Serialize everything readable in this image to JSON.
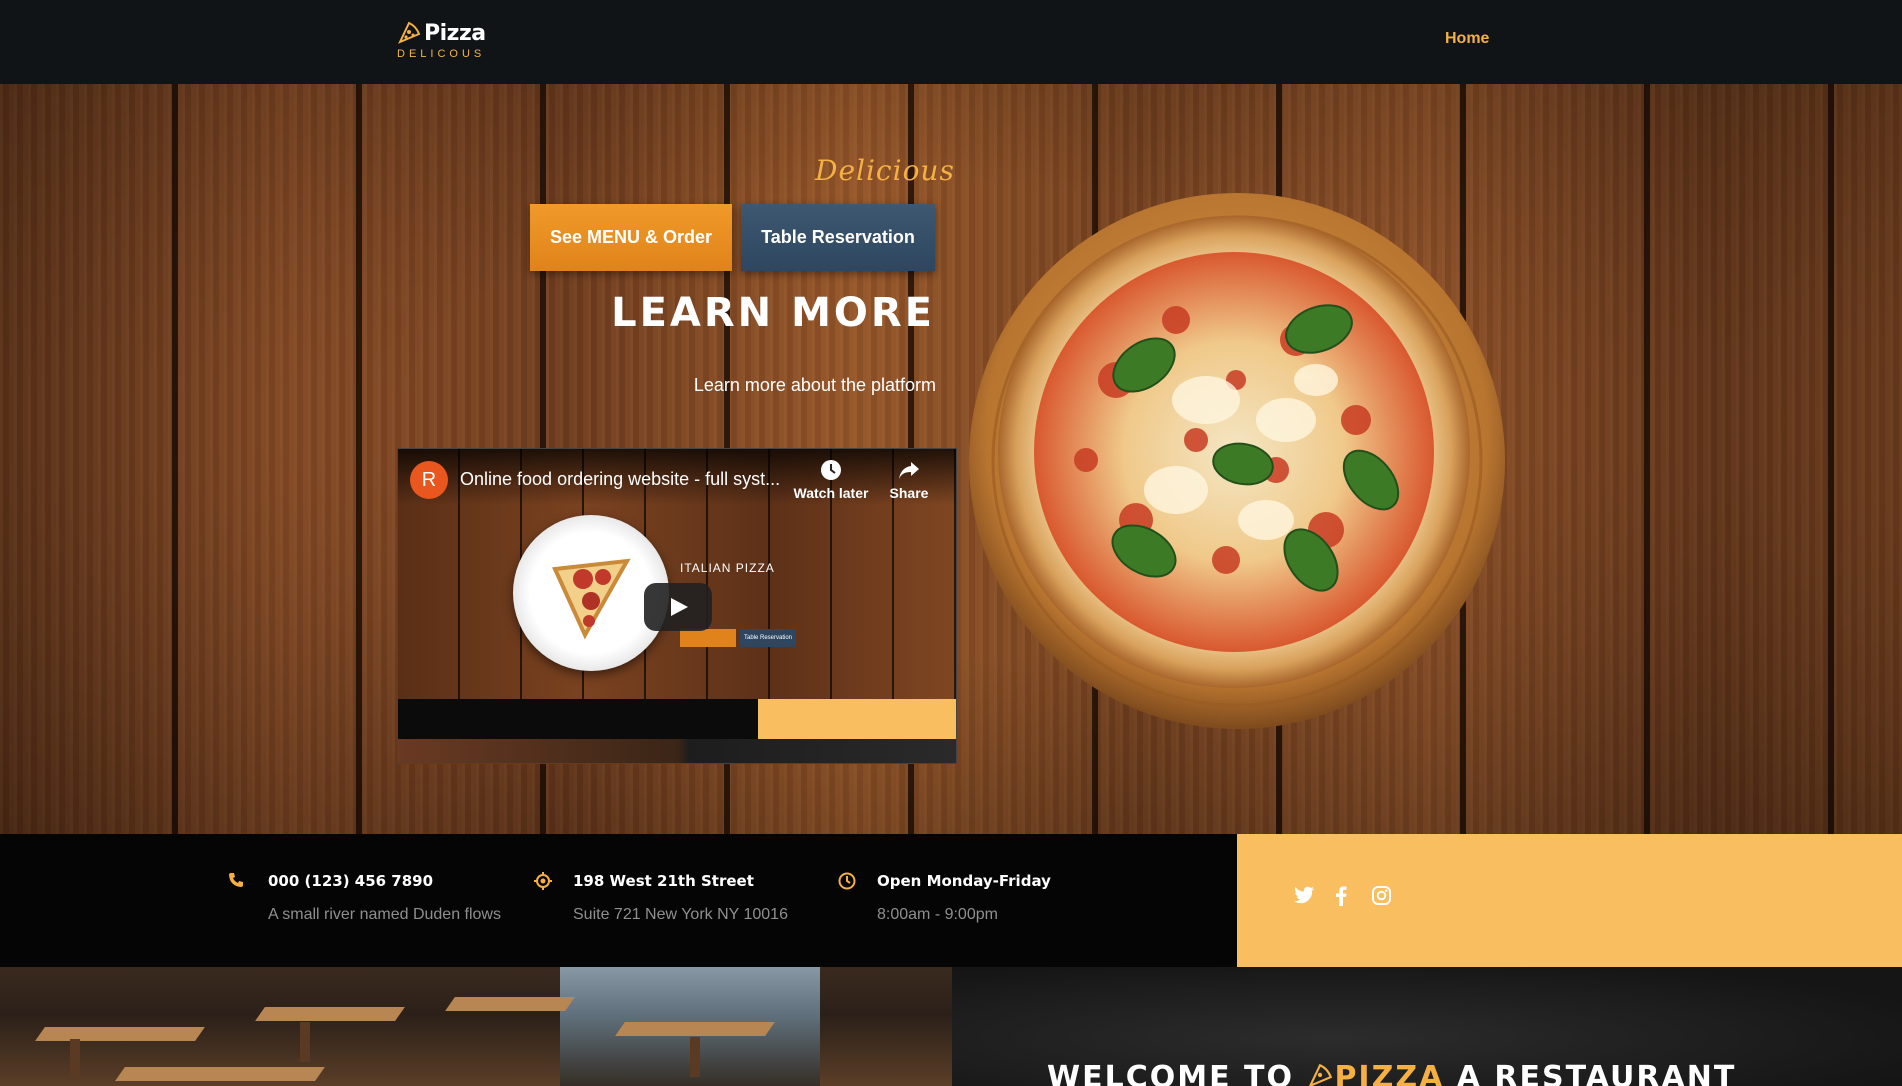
{
  "nav": {
    "logo_title": "Pizza",
    "logo_sub": "DELICOUS",
    "home_link": "Home"
  },
  "hero": {
    "script_text": "Delicious",
    "menu_button": "See MENU & Order",
    "table_button": "Table Reservation",
    "heading": "LEARN MORE",
    "subheading": "Learn more about the platform"
  },
  "video": {
    "channel_initial": "R",
    "title": "Online food ordering website - full syst...",
    "watch_later": "Watch later",
    "share": "Share",
    "inner_heading": "ITALIAN PIZZA",
    "inner_table_button": "Table Reservation"
  },
  "info": {
    "phone": {
      "title": "000 (123) 456 7890",
      "sub": "A small river named Duden flows"
    },
    "address": {
      "title": "198 West 21th Street",
      "sub": "Suite 721 New York NY 10016"
    },
    "hours": {
      "title": "Open Monday-Friday",
      "sub": "8:00am - 9:00pm"
    }
  },
  "social": {
    "icons": [
      "twitter-icon",
      "facebook-icon",
      "instagram-icon"
    ],
    "color": "#f8be5f"
  },
  "welcome": {
    "prefix": "WELCOME TO",
    "brand": "PIZZA",
    "suffix": "A RESTAURANT"
  },
  "colors": {
    "accent": "#f5b043",
    "menu_button": "#e88d20",
    "table_button": "#34506a",
    "nav_bg": "#111417"
  }
}
